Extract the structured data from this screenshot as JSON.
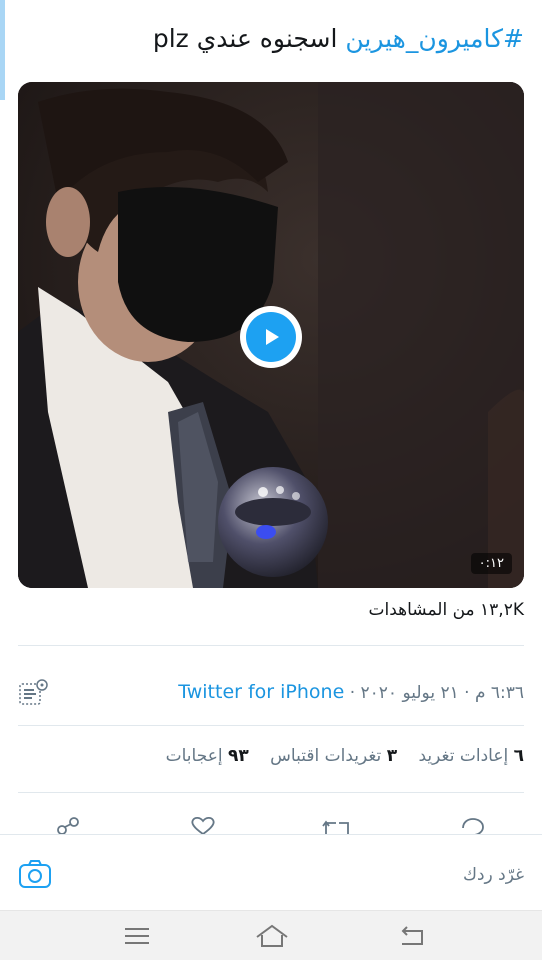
{
  "tweet": {
    "hashtag": "#كاميرون_هيرين",
    "body": " اسجنوه عندي plz"
  },
  "video": {
    "duration": "٠:١٢"
  },
  "views": {
    "count": "١٣,٢K",
    "label": " من المشاهدات"
  },
  "meta": {
    "time_date": "٦:٣٦ م · ٢١ يوليو ٢٠٢٠ · ",
    "source": "Twitter for iPhone"
  },
  "stats": {
    "retweets_count": "٦",
    "retweets_label": " إعادات تغريد",
    "quotes_count": "٣",
    "quotes_label": " تغريدات اقتباس",
    "likes_count": "٩٣",
    "likes_label": " إعجابات"
  },
  "reply": {
    "placeholder": "غرّد ردك"
  },
  "colors": {
    "accent": "#1da1f2",
    "link": "#1b95e0",
    "muted": "#657786"
  }
}
